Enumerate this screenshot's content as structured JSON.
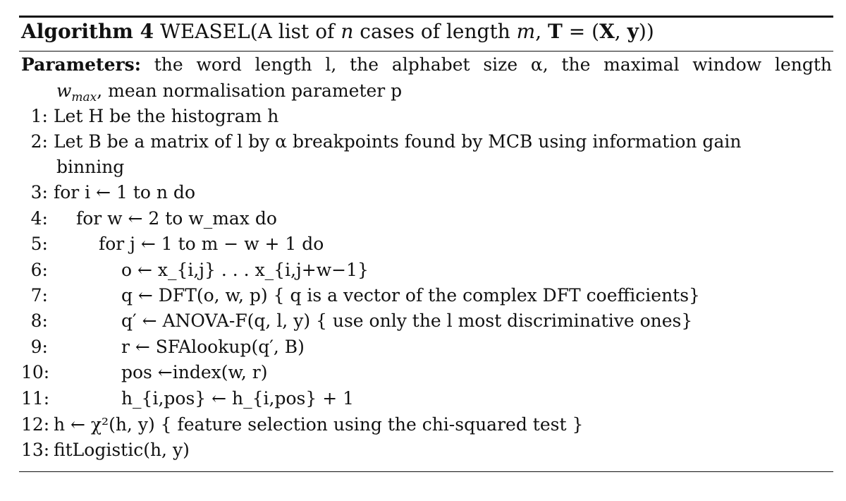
{
  "algorithm": {
    "label": "Algorithm 4",
    "name": "WEASEL",
    "signature_prefix": "(A list of ",
    "signature_n": "n",
    "signature_mid": " cases of length ",
    "signature_m": "m",
    "signature_comma": ", ",
    "signature_T": "T",
    "signature_eq": " = (",
    "signature_X": "X",
    "signature_sep": ", ",
    "signature_y": "y",
    "signature_end": "))"
  },
  "parameters": {
    "label": "Parameters:",
    "line1": "the word length l, the alphabet size α, the maximal window length",
    "line2_var": "w",
    "line2_sub": "max",
    "line2_rest": ", mean normalisation parameter p"
  },
  "steps": [
    {
      "num": "1:",
      "text": "Let H be the histogram h"
    },
    {
      "num": "2:",
      "text_a": "Let B be a matrix of l by α breakpoints found by MCB using information gain",
      "text_b": "binning"
    },
    {
      "num": "3:",
      "text": "for i ← 1 to n do"
    },
    {
      "num": "4:",
      "text": "for w ← 2 to w_max do"
    },
    {
      "num": "5:",
      "text": "for j ← 1 to m − w + 1 do"
    },
    {
      "num": "6:",
      "text": "o ← x_{i,j} . . . x_{i,j+w−1}"
    },
    {
      "num": "7:",
      "text": "q ← DFT(o, w, p) { q is a vector of the complex DFT coefficients}"
    },
    {
      "num": "8:",
      "text": "q′ ← ANOVA-F(q, l, y) { use only the l most discriminative ones}"
    },
    {
      "num": "9:",
      "text": "r ← SFAlookup(q′, B)"
    },
    {
      "num": "10:",
      "text": "pos ←index(w, r)"
    },
    {
      "num": "11:",
      "text": "h_{i,pos} ← h_{i,pos} + 1"
    },
    {
      "num": "12:",
      "text": "h ← χ²(h, y) { feature selection using the chi-squared test }"
    },
    {
      "num": "13:",
      "text": "fitLogistic(h, y)"
    }
  ]
}
